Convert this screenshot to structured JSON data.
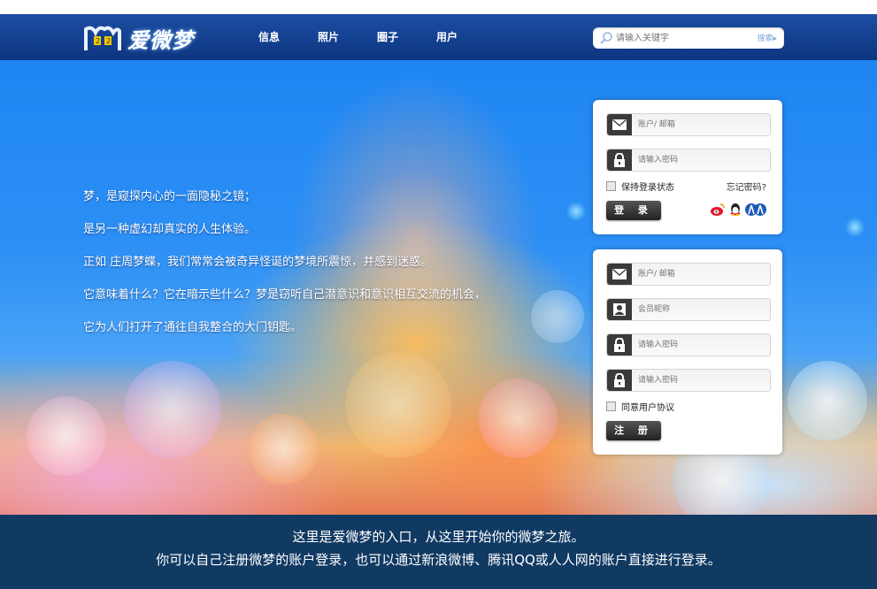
{
  "brand": {
    "logo_text": "爱微梦",
    "logo_mark": "m"
  },
  "nav": {
    "items": [
      "信息",
      "照片",
      "圈子",
      "用户"
    ]
  },
  "search": {
    "placeholder": "请输入关键字",
    "button": "搜索▸",
    "icon": "search-icon"
  },
  "intro": {
    "lines": [
      "梦，是窥探内心的一面隐秘之镜；",
      "是另一种虚幻却真实的人生体验。",
      "正如 庄周梦蝶，我们常常会被奇异怪诞的梦境所震惊，并感到迷惑。",
      "它意味着什么？它在暗示些什么？梦是窃听自己潜意识和意识相互交流的机会，",
      "它为人们打开了通往自我整合的大门钥匙。"
    ]
  },
  "login": {
    "account_placeholder": "账户/ 邮箱",
    "password_placeholder": "请输入密码",
    "remember_label": "保持登录状态",
    "forgot_label": "忘记密码?",
    "submit_label": "登 录",
    "social_icons": [
      "weibo-icon",
      "qq-icon",
      "renren-icon"
    ]
  },
  "register": {
    "account_placeholder": "账户/ 邮箱",
    "nickname_placeholder": "会员昵称",
    "password_placeholder": "请输入密码",
    "confirm_placeholder": "请输入密码",
    "agree_label": "同意用户协议",
    "submit_label": "注 册"
  },
  "footer": {
    "line1": "这里是爱微梦的入口，从这里开始你的微梦之旅。",
    "line2": "你可以自己注册微梦的账户登录，也可以通过新浪微博、腾讯QQ或人人网的账户直接进行登录。"
  },
  "colors": {
    "nav_bg": "#0d3580",
    "footer_bg": "#113a63",
    "button_bg": "#333333"
  }
}
